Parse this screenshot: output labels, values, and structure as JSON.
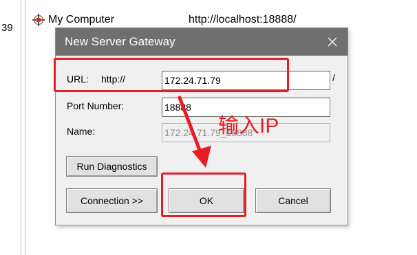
{
  "background": {
    "fragment": "39",
    "item_label": "My Computer",
    "item_icon": "network-computer-icon",
    "url": "http://localhost:18888/"
  },
  "dialog": {
    "title": "New Server Gateway",
    "close_icon": "close-icon",
    "url_label": "URL:",
    "url_prefix": "http://",
    "url_value": "172.24.71.79",
    "url_suffix": "/",
    "port_label": "Port Number:",
    "port_value": "18888",
    "name_label": "Name:",
    "name_value": "172.24.71.79_18888",
    "run_diagnostics_label": "Run Diagnostics",
    "connection_label": "Connection >>",
    "ok_label": "OK",
    "cancel_label": "Cancel"
  },
  "annotation": {
    "text": "输入IP",
    "color": "#e81c24"
  }
}
